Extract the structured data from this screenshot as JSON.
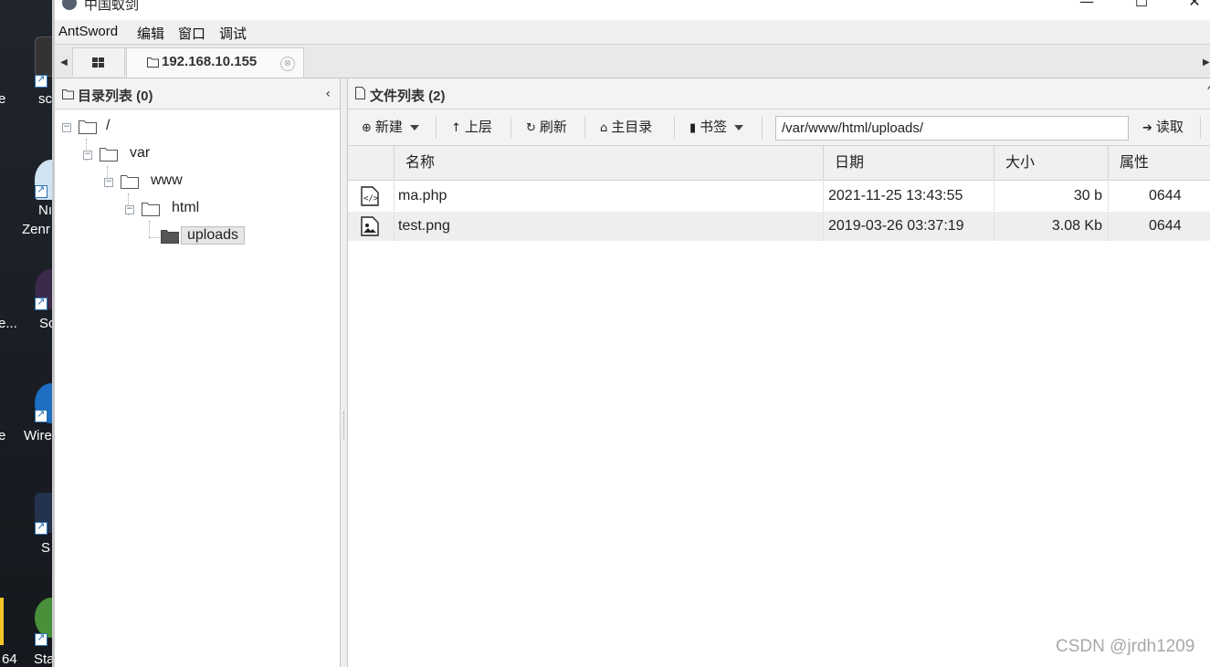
{
  "desktop": {
    "labels": [
      "e",
      "sc",
      "Nı",
      "Zenr",
      "e...",
      "Sc",
      "e",
      "Wire",
      "S",
      "Sta",
      "64"
    ]
  },
  "window": {
    "title": "中国蚁剑",
    "controls": {
      "minimize": "—",
      "maximize": "☐",
      "close": "✕"
    }
  },
  "menubar": {
    "items": [
      "AntSword",
      "编辑",
      "窗口",
      "调试"
    ]
  },
  "tabs": {
    "host_label": "192.168.10.155",
    "close_glyph": "⊗"
  },
  "directory_panel": {
    "title": "目录列表 (0)",
    "collapse_glyph": "‹",
    "tree": [
      {
        "label": "/",
        "toggle": "−"
      },
      {
        "label": "var",
        "toggle": "−"
      },
      {
        "label": "www",
        "toggle": "−"
      },
      {
        "label": "html",
        "toggle": "−"
      },
      {
        "label": "uploads",
        "selected": true
      }
    ]
  },
  "file_panel": {
    "title": "文件列表 (2)",
    "collapse_glyph": "˄",
    "toolbar": {
      "new_label": "新建",
      "up_label": "上层",
      "refresh_label": "刷新",
      "home_label": "主目录",
      "bookmark_label": "书签",
      "path_value": "/var/www/html/uploads/",
      "read_label": "读取"
    },
    "columns": [
      "名称",
      "日期",
      "大小",
      "属性"
    ],
    "rows": [
      {
        "icon": "code-file-icon",
        "name": "ma.php",
        "date": "2021-11-25 13:43:55",
        "size": "30 b",
        "attr": "0644"
      },
      {
        "icon": "image-file-icon",
        "name": "test.png",
        "date": "2019-03-26 03:37:19",
        "size": "3.08 Kb",
        "attr": "0644"
      }
    ]
  },
  "watermark": "CSDN @jrdh1209",
  "colors": {
    "panel_header": "#f3f3f3",
    "row_alt": "#eeeeee",
    "selected_node": "#e6e6e6"
  }
}
